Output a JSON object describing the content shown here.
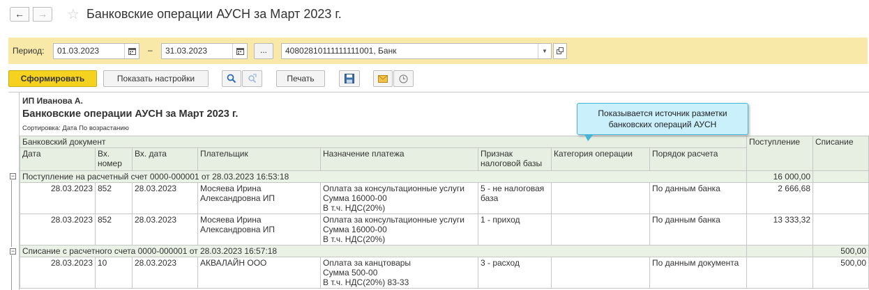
{
  "window": {
    "back_glyph": "←",
    "forward_glyph": "→",
    "star_glyph": "☆",
    "title": "Банковские операции АУСН за Март 2023 г."
  },
  "period": {
    "label": "Период:",
    "from": "01.03.2023",
    "to": "31.03.2023",
    "dash": "–",
    "dots": "...",
    "account": "40802810111111111001, Банк"
  },
  "toolbar": {
    "generate": "Сформировать",
    "show_settings": "Показать настройки",
    "print": "Печать"
  },
  "report": {
    "org": "ИП Иванова А.",
    "title": "Банковские операции АУСН  за Март 2023 г.",
    "sort": "Сортировка: Дата По возрастанию",
    "tooltip_line1": "Показывается источник разметки",
    "tooltip_line2": "банковских операций АУСН",
    "headers": {
      "bank_doc": "Банковский документ",
      "date": "Дата",
      "in_no_1": "Вх.",
      "in_no_2": "номер",
      "in_date": "Вх. дата",
      "payer": "Плательщик",
      "purpose": "Назначение платежа",
      "tax_base_1": "Признак",
      "tax_base_2": "налоговой базы",
      "category": "Категория операции",
      "calc_order": "Порядок расчета",
      "income": "Поступление",
      "expense": "Списание"
    },
    "groups": [
      {
        "title": "Поступление на расчетный счет 0000-000001 от 28.03.2023 16:53:18",
        "income": "16 000,00",
        "expense": "",
        "rows": [
          {
            "date": "28.03.2023",
            "in_no": "852",
            "in_date": "28.03.2023",
            "payer_1": "Мосяева Ирина",
            "payer_2": "Александровна ИП",
            "purpose_1": "Оплата за консультационные услуги",
            "purpose_2": "Сумма 16000-00",
            "purpose_3": "В т.ч. НДС(20%)",
            "tax_1": "5 - не налоговая",
            "tax_2": "база",
            "category": "",
            "order": "По данным банка",
            "income": "2 666,68",
            "expense": ""
          },
          {
            "date": "28.03.2023",
            "in_no": "852",
            "in_date": "28.03.2023",
            "payer_1": "Мосяева Ирина",
            "payer_2": "Александровна ИП",
            "purpose_1": "Оплата за консультационные услуги",
            "purpose_2": "Сумма 16000-00",
            "purpose_3": "В т.ч. НДС(20%)",
            "tax_1": "1 - приход",
            "tax_2": "",
            "category": "",
            "order": "По данным банка",
            "income": "13 333,32",
            "expense": ""
          }
        ]
      },
      {
        "title": "Списание с расчетного счета 0000-000001 от 28.03.2023 16:57:18",
        "income": "",
        "expense": "500,00",
        "rows": [
          {
            "date": "28.03.2023",
            "in_no": "10",
            "in_date": "28.03.2023",
            "payer_1": "АКВАЛАЙН ООО",
            "payer_2": "",
            "purpose_1": "Оплата за канцтовары",
            "purpose_2": "Сумма 500-00",
            "purpose_3": "В т.ч. НДС(20%) 83-33",
            "tax_1": "3 - расход",
            "tax_2": "",
            "category": "",
            "order": "По данным документа",
            "income": "",
            "expense": "500,00"
          }
        ]
      }
    ]
  },
  "colors": {
    "period_panel": "#f8e9a8",
    "generate_button": "#f5d21f",
    "header_bg": "#e6efe1",
    "tooltip_bg": "#c9f0fb",
    "tooltip_border": "#43b6d6"
  }
}
